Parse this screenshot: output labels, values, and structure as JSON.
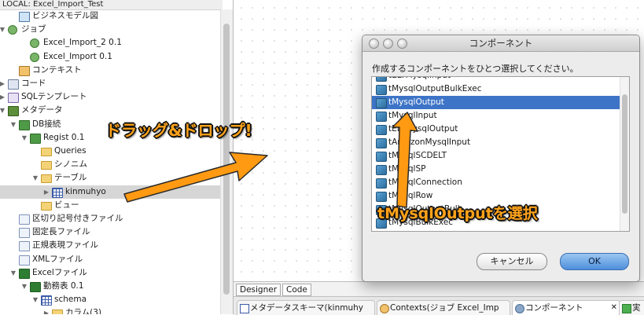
{
  "repository": {
    "title": "LOCAL: Excel_Import_Test",
    "items": [
      {
        "label": "ビジネスモデル図",
        "level": 1,
        "twisty": "",
        "icon": "business-model-icon",
        "selected": false
      },
      {
        "label": "ジョブ",
        "level": 0,
        "twisty": "▼",
        "icon": "job-folder-icon",
        "selected": false
      },
      {
        "label": "Excel_Import_2 0.1",
        "level": 2,
        "twisty": "",
        "icon": "job-icon",
        "selected": false
      },
      {
        "label": "Excel_Import 0.1",
        "level": 2,
        "twisty": "",
        "icon": "job-icon",
        "selected": false
      },
      {
        "label": "コンテキスト",
        "level": 1,
        "twisty": "",
        "icon": "context-icon",
        "selected": false
      },
      {
        "label": "コード",
        "level": 0,
        "twisty": "▶",
        "icon": "code-icon",
        "selected": false
      },
      {
        "label": "SQLテンプレート",
        "level": 0,
        "twisty": "▶",
        "icon": "sql-template-icon",
        "selected": false
      },
      {
        "label": "メタデータ",
        "level": 0,
        "twisty": "▼",
        "icon": "metadata-icon",
        "selected": false
      },
      {
        "label": "DB接続",
        "level": 1,
        "twisty": "▼",
        "icon": "db-connection-icon",
        "selected": false
      },
      {
        "label": "Regist 0.1",
        "level": 2,
        "twisty": "▼",
        "icon": "db-connection-icon",
        "selected": false
      },
      {
        "label": "Queries",
        "level": 3,
        "twisty": "",
        "icon": "folder-icon",
        "selected": false
      },
      {
        "label": "シノニム",
        "level": 3,
        "twisty": "",
        "icon": "folder-icon",
        "selected": false
      },
      {
        "label": "テーブル",
        "level": 3,
        "twisty": "▼",
        "icon": "folder-icon",
        "selected": false
      },
      {
        "label": "kinmuhyo",
        "level": 4,
        "twisty": "▶",
        "icon": "table-icon",
        "selected": true
      },
      {
        "label": "ビュー",
        "level": 3,
        "twisty": "",
        "icon": "folder-icon",
        "selected": false
      },
      {
        "label": "区切り記号付きファイル",
        "level": 1,
        "twisty": "",
        "icon": "delimited-file-icon",
        "selected": false
      },
      {
        "label": "固定長ファイル",
        "level": 1,
        "twisty": "",
        "icon": "positional-file-icon",
        "selected": false
      },
      {
        "label": "正規表現ファイル",
        "level": 1,
        "twisty": "",
        "icon": "regex-file-icon",
        "selected": false
      },
      {
        "label": "XMLファイル",
        "level": 1,
        "twisty": "",
        "icon": "xml-file-icon",
        "selected": false
      },
      {
        "label": "Excelファイル",
        "level": 1,
        "twisty": "▼",
        "icon": "excel-file-icon",
        "selected": false
      },
      {
        "label": "勤務表 0.1",
        "level": 2,
        "twisty": "▼",
        "icon": "excel-file-icon",
        "selected": false
      },
      {
        "label": "schema",
        "level": 3,
        "twisty": "▼",
        "icon": "table-icon",
        "selected": false
      },
      {
        "label": "カラム(3)",
        "level": 4,
        "twisty": "▶",
        "icon": "folder-icon",
        "selected": false
      }
    ]
  },
  "designer_tabs": [
    "Designer",
    "Code"
  ],
  "bottom_tabs": [
    {
      "label": "メタデータスキーマ(kinmuhy",
      "icon": "schema-icon"
    },
    {
      "label": "Contexts(ジョブ Excel_Imp",
      "icon": "contexts-icon"
    },
    {
      "label": "コンポーネント",
      "icon": "component-icon",
      "close": "✕"
    },
    {
      "label": "実",
      "icon": "run-icon"
    }
  ],
  "dialog": {
    "title": "コンポーネント",
    "prompt": "作成するコンポーネントをひとつ選択してください。",
    "items": [
      {
        "label": "tELTMysqlInput",
        "selected": false
      },
      {
        "label": "tMysqlOutputBulkExec",
        "selected": false
      },
      {
        "label": "tMysqlOutput",
        "selected": true
      },
      {
        "label": "tMysqlInput",
        "selected": false
      },
      {
        "label": "tELTMysqlOutput",
        "selected": false
      },
      {
        "label": "tAmazonMysqlInput",
        "selected": false
      },
      {
        "label": "tMysqlSCDELT",
        "selected": false
      },
      {
        "label": "tMysqlSP",
        "selected": false
      },
      {
        "label": "tMysqlConnection",
        "selected": false
      },
      {
        "label": "tMysqlRow",
        "selected": false
      },
      {
        "label": "tMysqlOutputBulk",
        "selected": false
      },
      {
        "label": "tMysqlBulkExec",
        "selected": false
      }
    ],
    "cancel_label": "キャンセル",
    "ok_label": "OK"
  },
  "annotations": {
    "drag_text": "ドラッグ&ドロップ!",
    "select_text": "tMysqlOutputを選択",
    "color": "#ffa21a"
  }
}
